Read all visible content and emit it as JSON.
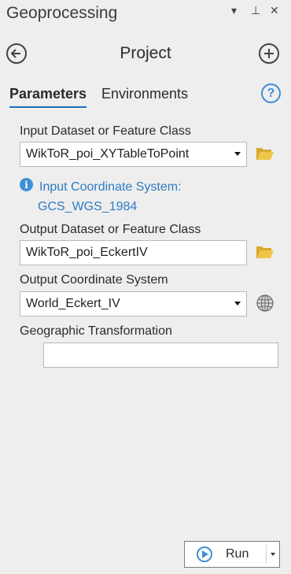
{
  "pane": {
    "title": "Geoprocessing",
    "controls": {
      "pin_menu": "▾",
      "pin": "⊥",
      "close": "✕"
    }
  },
  "tool": {
    "title": "Project"
  },
  "tabs": [
    {
      "label": "Parameters",
      "active": true
    },
    {
      "label": "Environments",
      "active": false
    }
  ],
  "help": {
    "symbol": "?"
  },
  "params": {
    "input_dataset": {
      "label": "Input Dataset or Feature Class",
      "value": "WikToR_poi_XYTableToPoint"
    },
    "input_coord": {
      "label": "Input Coordinate System:",
      "value": "GCS_WGS_1984"
    },
    "output_dataset": {
      "label": "Output Dataset or Feature Class",
      "value": "WikToR_poi_EckertIV"
    },
    "output_coord": {
      "label": "Output Coordinate System",
      "value": "World_Eckert_IV"
    },
    "geo_transform": {
      "label": "Geographic Transformation",
      "value": ""
    }
  },
  "run": {
    "label": "Run"
  },
  "colors": {
    "background": "#eeeeee",
    "accent_blue": "#3f8fd6",
    "info_text": "#2e7bc4",
    "folder_yellow": "#e5b93b"
  },
  "icons": {
    "back": "arrow-left-circle-icon",
    "add": "plus-circle-icon",
    "help": "question-circle-icon",
    "info": "info-icon",
    "folder": "folder-icon",
    "globe": "globe-icon",
    "run": "play-icon"
  }
}
